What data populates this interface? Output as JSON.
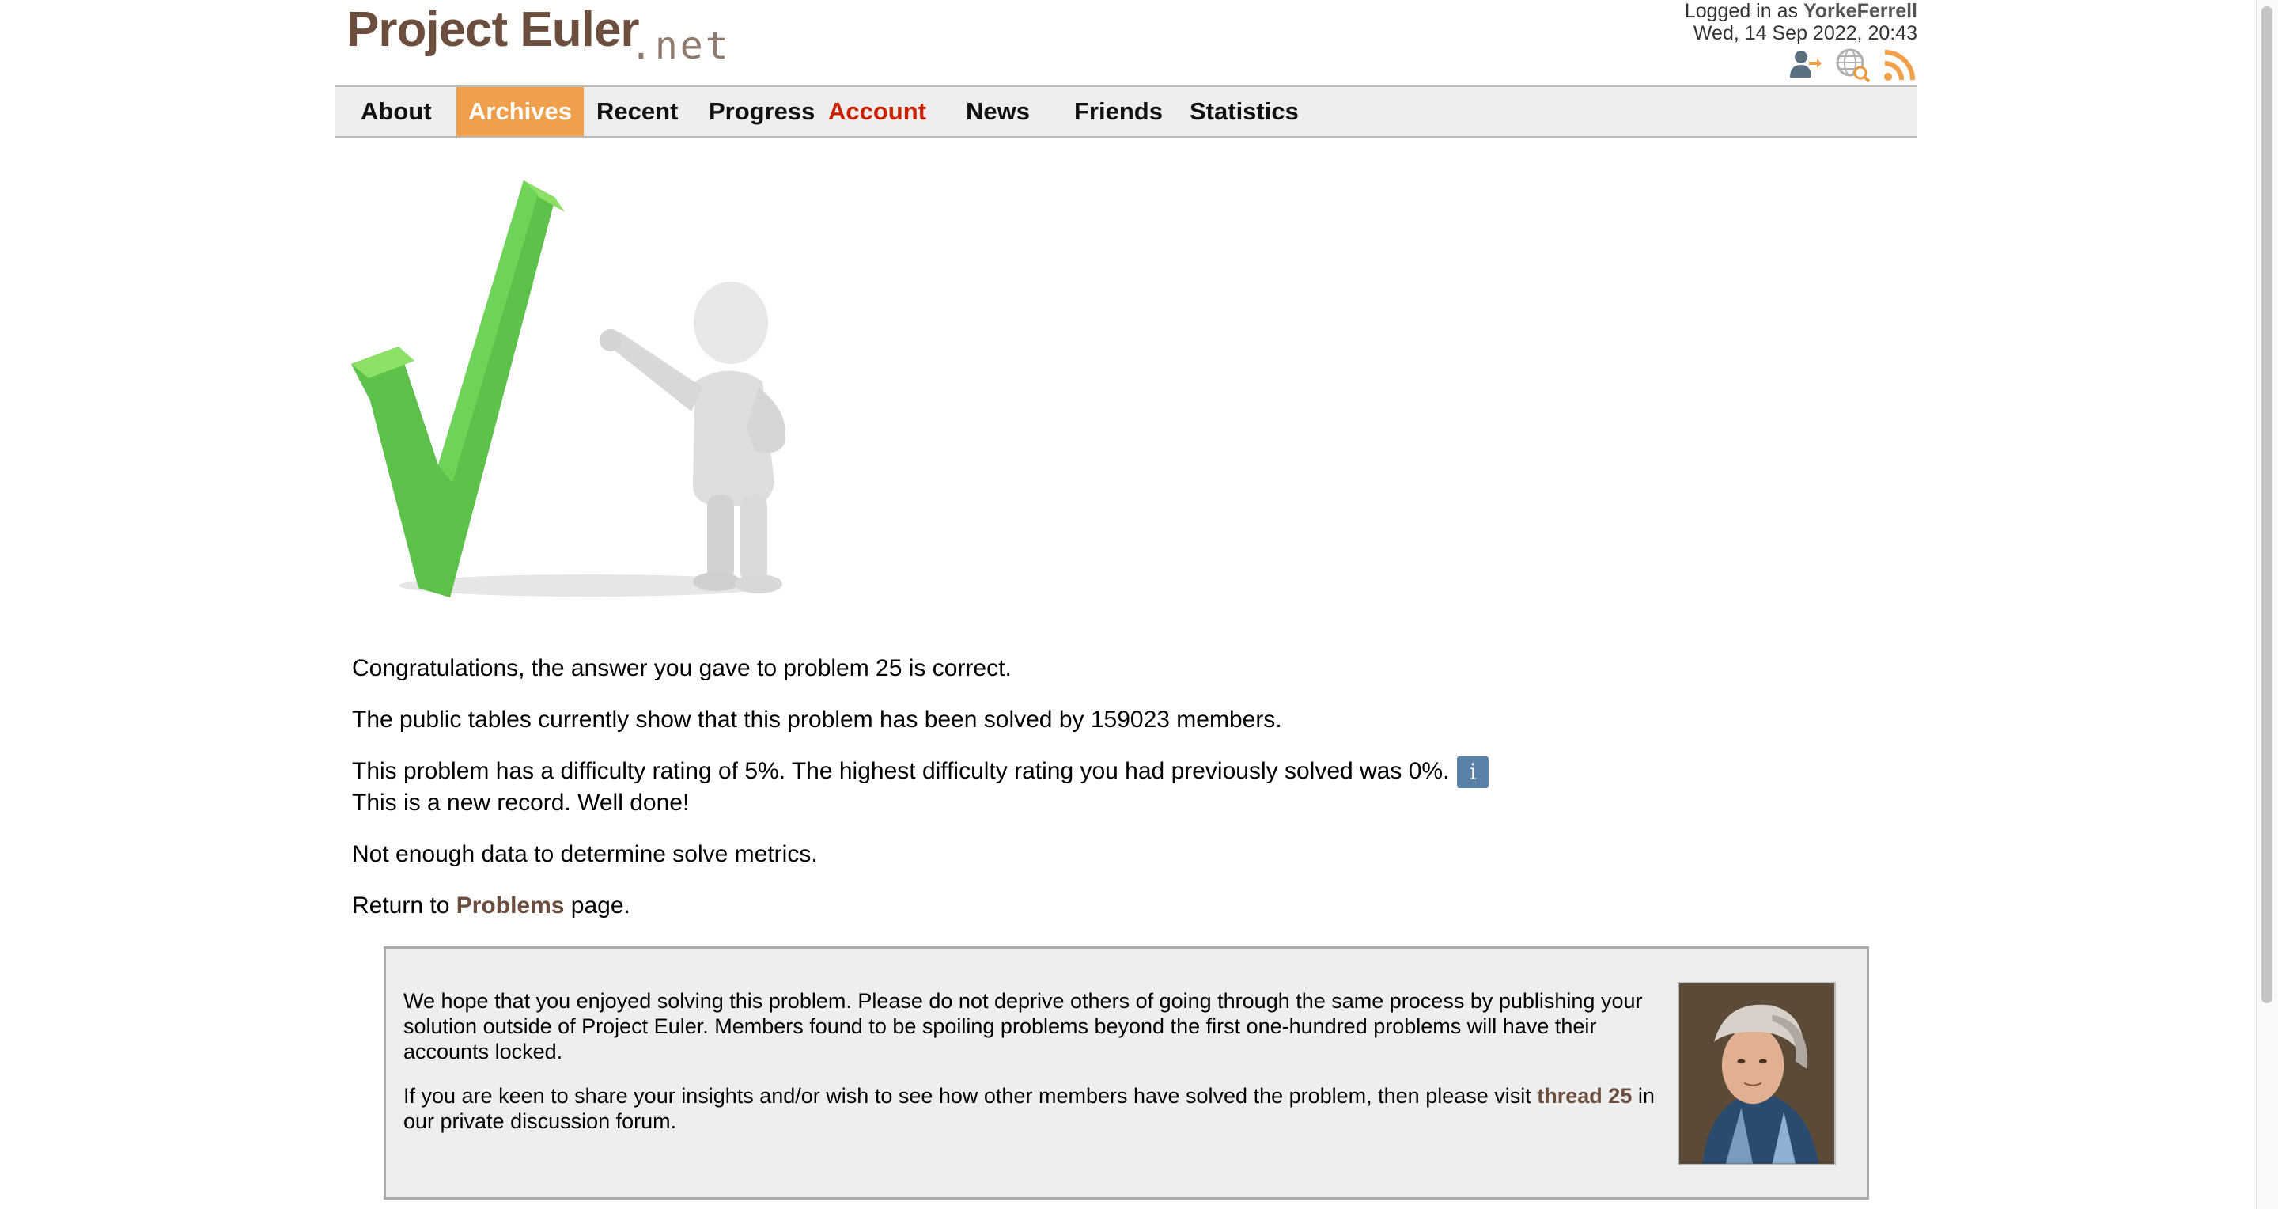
{
  "header": {
    "logo_main": "Project Euler",
    "logo_suffix": ".net",
    "login_prefix": "Logged in as ",
    "username": "YorkeFerrell",
    "datetime": "Wed, 14 Sep 2022, 20:43",
    "icons": [
      "account-logout-icon",
      "global-search-icon",
      "rss-feed-icon"
    ]
  },
  "nav": {
    "items": [
      {
        "label": "About"
      },
      {
        "label": "Archives"
      },
      {
        "label": "Recent"
      },
      {
        "label": "Progress"
      },
      {
        "label": "Account"
      },
      {
        "label": "News"
      },
      {
        "label": "Friends"
      },
      {
        "label": "Statistics"
      }
    ],
    "active": "Archives"
  },
  "content": {
    "congrats": "Congratulations, the answer you gave to problem 25 is correct.",
    "solved_by": "The public tables currently show that this problem has been solved by 159023 members.",
    "difficulty": "This problem has a difficulty rating of 5%. The highest difficulty rating you had previously solved was 0%.",
    "info_label": "i",
    "record": "This is a new record. Well done!",
    "metrics": "Not enough data to determine solve metrics.",
    "return_prefix": "Return to ",
    "return_link": "Problems",
    "return_suffix": " page."
  },
  "notice": {
    "para1": "We hope that you enjoyed solving this problem. Please do not deprive others of going through the same process by publishing your solution outside of Project Euler. Members found to be spoiling problems beyond the first one-hundred problems will have their accounts locked.",
    "para2_prefix": "If you are keen to share your insights and/or wish to see how other members have solved the problem, then please visit ",
    "para2_link": "thread 25",
    "para2_suffix": " in our private discussion forum."
  },
  "colors": {
    "brand_brown": "#6b4e3d",
    "nav_active_bg": "#f0a04b",
    "account_red": "#cc2200",
    "check_green": "#5cc24a",
    "info_blue": "#5a82a8"
  }
}
